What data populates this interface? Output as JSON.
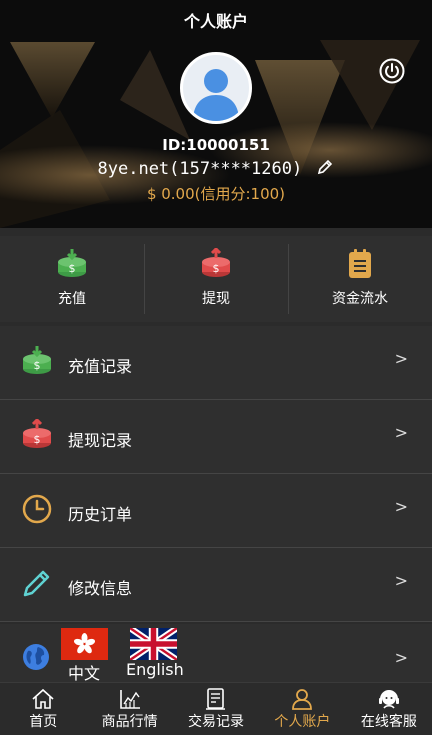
{
  "header": {
    "title": "个人账户",
    "user_id": "ID:10000151",
    "username": "8ye.net(157****1260)",
    "balance": "$ 0.00(信用分:100)"
  },
  "quick_actions": [
    {
      "label": "充值",
      "icon": "deposit-icon"
    },
    {
      "label": "提现",
      "icon": "withdraw-icon"
    },
    {
      "label": "资金流水",
      "icon": "ledger-icon"
    }
  ],
  "menu": [
    {
      "label": "充值记录",
      "arrow": ">",
      "icon": "deposit-icon"
    },
    {
      "label": "提现记录",
      "arrow": ">",
      "icon": "withdraw-icon"
    },
    {
      "label": "历史订单",
      "arrow": ">",
      "icon": "clock-icon"
    },
    {
      "label": "修改信息",
      "arrow": ">",
      "icon": "pencil-icon"
    }
  ],
  "language": {
    "zh_label": "中文",
    "en_label": "English",
    "arrow": ">"
  },
  "tabbar": [
    {
      "label": "首页",
      "icon": "home-icon"
    },
    {
      "label": "商品行情",
      "icon": "chart-icon"
    },
    {
      "label": "交易记录",
      "icon": "record-icon"
    },
    {
      "label": "个人账户",
      "icon": "user-icon",
      "active": true
    },
    {
      "label": "在线客服",
      "icon": "support-icon"
    }
  ],
  "colors": {
    "accent": "#e2a84c",
    "deposit": "#4caf50",
    "withdraw": "#e04b4b",
    "ledger": "#e2a84c",
    "globe": "#3d7ee0",
    "pencil": "#5fd2d2"
  }
}
